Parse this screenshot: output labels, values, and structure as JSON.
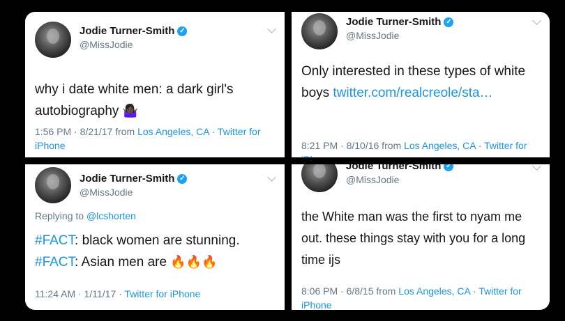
{
  "author": {
    "name": "Jodie Turner-Smith",
    "handle": "@MissJodie",
    "verified_mark": "✓"
  },
  "tweets": [
    {
      "text": "why i date white men: a dark girl's autobiography",
      "emoji": "🤷🏿‍♀️",
      "time": "1:56 PM · 8/21/17 from ",
      "location": "Los Angeles, CA",
      "sep": " · ",
      "source": "Twitter for iPhone"
    },
    {
      "text_before": "Only interested in these types of white boys ",
      "link": "twitter.com/realcreole/sta…",
      "time": "8:21 PM · 8/10/16 from ",
      "location": "Los Angeles, CA",
      "sep": " · ",
      "source": "Twitter for iPhone"
    },
    {
      "reply_prefix": "Replying to ",
      "reply_to": "@lcshorten",
      "hashtag1": "#FACT",
      "line1": ": black women are stunning.",
      "hashtag2": "#FACT",
      "line2": ": Asian men are ",
      "emoji": "🔥🔥🔥",
      "time": "11:24 AM · 1/11/17 · ",
      "source": "Twitter for iPhone"
    },
    {
      "text": "the White man was the first to nyam me out. these things stay with you for a long time ijs",
      "time": "8:06 PM · 6/8/15 from ",
      "location": "Los Angeles, CA",
      "sep": " · ",
      "source": "Twitter for iPhone"
    }
  ]
}
